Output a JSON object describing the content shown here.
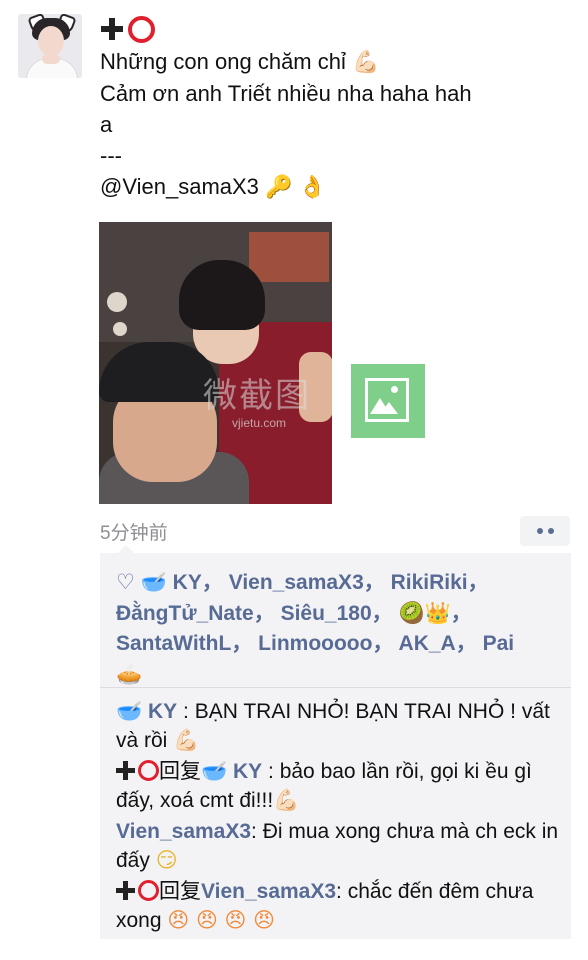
{
  "author": {
    "name_icons": [
      "plus-icon",
      "red-circle-icon"
    ],
    "avatar": "avatar-photo"
  },
  "post": {
    "line1": "Những con ong chăm chỉ",
    "line2": "Cảm ơn anh Triết nhiều nha haha hah",
    "line3": "a",
    "line4": "---",
    "line5": "@Vien_samaX3",
    "emoji_arm": "💪🏻",
    "emoji_key": "🔑",
    "emoji_ok": "👌"
  },
  "watermark": {
    "text": "微截图",
    "url": "vjietu.com"
  },
  "meta": {
    "time": "5分钟前"
  },
  "likes": {
    "heart": "♡",
    "names": [
      {
        "icon": "🥣",
        "name": "KY"
      },
      {
        "name": "Vien_samaX3"
      },
      {
        "name": "RikiRiki"
      },
      {
        "name": "ĐằngTử_Nate"
      },
      {
        "name": "Siêu_180"
      },
      {
        "icon": "🥝👑"
      },
      {
        "name": "SantaWithL"
      },
      {
        "name": "Linmooooo"
      },
      {
        "name": "AK_A"
      },
      {
        "name": "Pai"
      },
      {
        "icon": "🥧"
      }
    ],
    "sep": "，"
  },
  "comments": [
    {
      "nick": "KY",
      "sep": " : ",
      "text": "BẠN TRAI NHỎ! BẠN TRAI NHỎ ! vất và rồi",
      "emoji": "💪🏻"
    },
    {
      "reply_word": "回复",
      "nick": "KY",
      "sep": " : ",
      "text": "bảo bao lần rồi, gọi ki ều gì đấy, xoá cmt đi!!!",
      "emoji": "💪🏻"
    },
    {
      "nick": "Vien_samaX3",
      "sep": ": ",
      "text": "Đi mua xong chưa mà ch eck in đấy",
      "emoji": "😏"
    },
    {
      "reply_word": "回复",
      "nick": "Vien_samaX3",
      "sep": ": ",
      "text": "chắc đến đêm chưa xong",
      "emoji": "😠 😠 😠 😠"
    }
  ]
}
